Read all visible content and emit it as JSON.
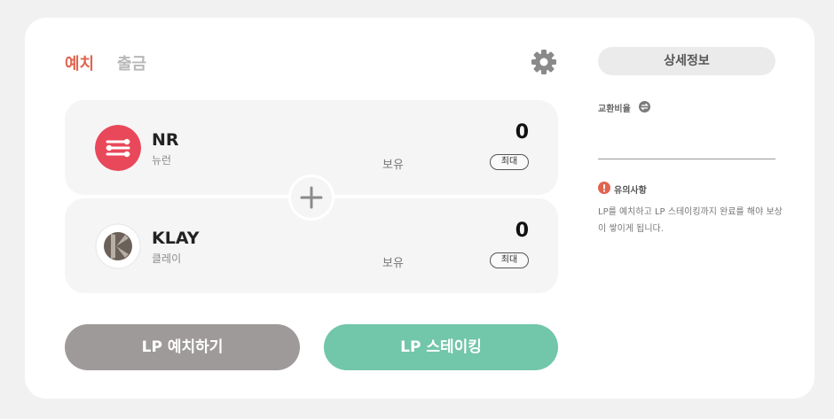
{
  "tabs": {
    "deposit": "예치",
    "withdraw": "출금"
  },
  "tokens": [
    {
      "symbol": "NR",
      "name": "뉴런",
      "holding_label": "보유",
      "amount": "0",
      "max_label": "최대",
      "icon": "neuron-logo-icon",
      "icon_color": "#e8485a"
    },
    {
      "symbol": "KLAY",
      "name": "클레이",
      "holding_label": "보유",
      "amount": "0",
      "max_label": "최대",
      "icon": "klay-logo-icon",
      "icon_color": "#6b6158"
    }
  ],
  "actions": {
    "deposit_lp": "LP 예치하기",
    "stake_lp": "LP 스테이킹"
  },
  "sidebar": {
    "detail_button": "상세정보",
    "exchange_ratio_label": "교환비율",
    "notice_title": "유의사항",
    "notice_text": "LP를 예치하고 LP 스테이킹까지 완료를 해야 보상이 쌓이게 됩니다."
  },
  "colors": {
    "accent": "#e0644f",
    "deposit_button": "#9f9a9a",
    "stake_button": "#72c6aa",
    "warning": "#e0644f"
  }
}
